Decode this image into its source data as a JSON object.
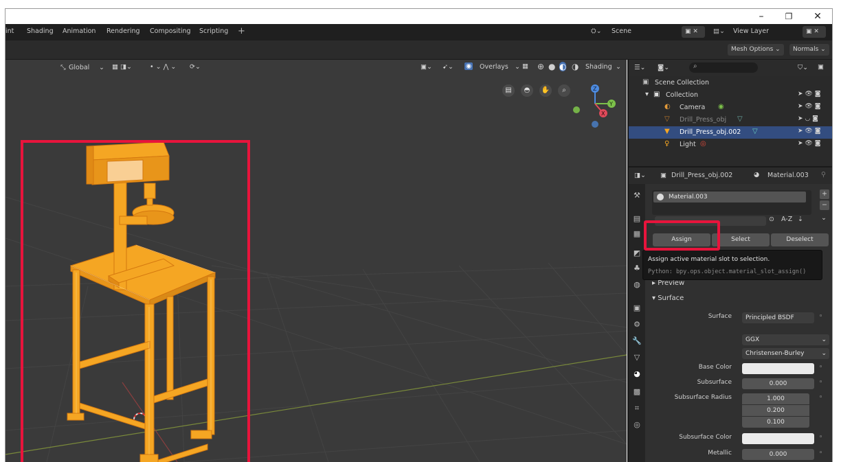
{
  "window": {
    "minimize": "–",
    "maximize": "❐",
    "close": "✕"
  },
  "workspace_tabs": [
    "int",
    "Shading",
    "Animation",
    "Rendering",
    "Compositing",
    "Scripting"
  ],
  "workspace_add": "+",
  "scene": {
    "label": "Scene",
    "view_layer": "View Layer"
  },
  "mesh_bar": {
    "mesh_options": "Mesh Options ⌄",
    "normals": "Normals ⌄"
  },
  "viewport": {
    "orientation": "Global",
    "overlays": "Overlays",
    "shading": "Shading",
    "gizmo_axes": {
      "z": "Z",
      "y": "Y",
      "x": "X"
    }
  },
  "outliner": {
    "search_placeholder": "",
    "items": [
      {
        "label": "Scene Collection"
      },
      {
        "label": "Collection"
      },
      {
        "label": "Camera"
      },
      {
        "label": "Drill_Press_obj"
      },
      {
        "label": "Drill_Press_obj.002"
      },
      {
        "label": "Light"
      }
    ]
  },
  "properties": {
    "object_name": "Drill_Press_obj.002",
    "material_name": "Material.003",
    "slot_name": "Material.003",
    "sort_label": "A-Z",
    "buttons": {
      "assign": "Assign",
      "select": "Select",
      "deselect": "Deselect"
    },
    "tooltip": {
      "title": "Assign active material slot to selection.",
      "python": "Python: bpy.ops.object.material_slot_assign()"
    },
    "sections": {
      "preview": "Preview",
      "surface": "Surface"
    },
    "surface": {
      "surface_label": "Surface",
      "surface_value": "Principled BSDF",
      "distribution": "GGX",
      "subsurface_method": "Christensen-Burley",
      "base_color_label": "Base Color",
      "subsurface_label": "Subsurface",
      "subsurface_value": "0.000",
      "radius_label": "Subsurface Radius",
      "radius_values": [
        "1.000",
        "0.200",
        "0.100"
      ],
      "subsurface_color_label": "Subsurface Color",
      "metallic_label": "Metallic",
      "metallic_value": "0.000"
    }
  },
  "colors": {
    "selection": "#e8143c",
    "accent_blue": "#334d80",
    "object_orange": "#f5a623"
  }
}
